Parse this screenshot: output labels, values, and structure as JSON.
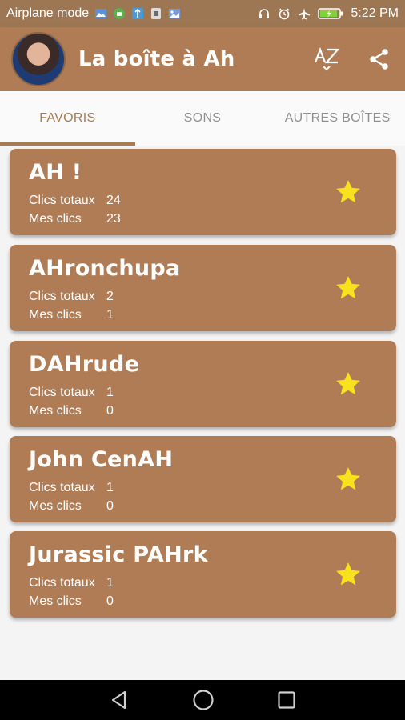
{
  "status_bar": {
    "airplane_label": "Airplane mode",
    "time": "5:22 PM",
    "left_icons": [
      "photo-icon",
      "android-icon",
      "usb-icon",
      "sim-icon",
      "image-icon"
    ],
    "right_icons": [
      "headphones-icon",
      "alarm-icon",
      "airplane-icon",
      "battery-charging-icon"
    ]
  },
  "app_bar": {
    "title": "La boîte à Ah",
    "sort_icon": "sort-az-icon",
    "share_icon": "share-icon"
  },
  "tabs": [
    {
      "label": "FAVORIS",
      "active": true
    },
    {
      "label": "SONS",
      "active": false
    },
    {
      "label": "AUTRES BOÎTES",
      "active": false
    }
  ],
  "stats_labels": {
    "total": "Clics totaux",
    "mine": "Mes clics"
  },
  "sounds": [
    {
      "title": "AH !",
      "total": "24",
      "mine": "23",
      "favorite": true
    },
    {
      "title": "AHronchupa",
      "total": "2",
      "mine": "1",
      "favorite": true
    },
    {
      "title": "DAHrude",
      "total": "1",
      "mine": "0",
      "favorite": true
    },
    {
      "title": "John CenAH",
      "total": "1",
      "mine": "0",
      "favorite": true
    },
    {
      "title": "Jurassic PAHrk",
      "total": "1",
      "mine": "0",
      "favorite": true
    }
  ],
  "colors": {
    "primary": "#b07c55",
    "status_bar": "#9d7754",
    "star": "#f8e21e",
    "tab_inactive": "#8f8f8f"
  }
}
